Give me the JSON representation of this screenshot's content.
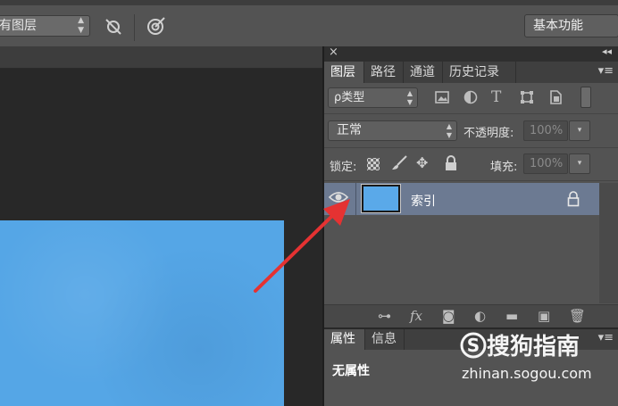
{
  "topbar": {
    "sample_label": "有图层",
    "workspace_label": "基本功能"
  },
  "panel": {
    "tabs": [
      "图层",
      "路径",
      "通道",
      "历史记录"
    ],
    "active_tab": "图层",
    "filter_label": "ρ类型",
    "blend_mode": "正常",
    "opacity_label": "不透明度:",
    "opacity_value": "100%",
    "lock_label": "锁定:",
    "fill_label": "填充:",
    "fill_value": "100%",
    "layers": [
      {
        "name": "索引",
        "visible": true,
        "locked": true
      }
    ]
  },
  "properties": {
    "tabs": [
      "属性",
      "信息"
    ],
    "text": "无属性"
  },
  "watermark": {
    "title": "搜狗指南",
    "url": "zhinan.sogou.com"
  },
  "colors": {
    "canvas_blue": "#55a6e6",
    "selected_layer": "#6c7a92",
    "arrow_red": "#e53232"
  }
}
